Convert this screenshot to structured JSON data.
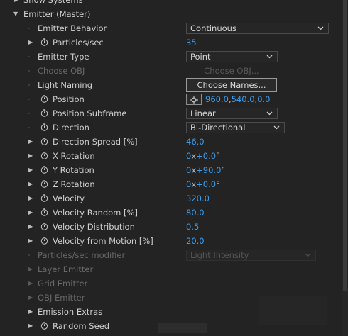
{
  "show_systems_label": "Show Systems",
  "emitter_title": "Emitter (Master)",
  "rows": {
    "emitter_behavior": {
      "label": "Emitter Behavior",
      "value": "Continuous"
    },
    "particles_sec": {
      "label": "Particles/sec",
      "value": "35"
    },
    "emitter_type": {
      "label": "Emitter Type",
      "value": "Point"
    },
    "choose_obj": {
      "label": "Choose OBJ",
      "value": "Choose OBJ..."
    },
    "light_naming": {
      "label": "Light Naming",
      "value": "Choose Names..."
    },
    "position": {
      "label": "Position",
      "x": "960.0",
      "y": "540.0",
      "z": "0.0"
    },
    "position_subframe": {
      "label": "Position Subframe",
      "value": "Linear"
    },
    "direction": {
      "label": "Direction",
      "value": "Bi-Directional"
    },
    "direction_spread": {
      "label": "Direction Spread [%]",
      "value": "46.0"
    },
    "x_rotation": {
      "label": "X Rotation",
      "rev": "0",
      "x": "x",
      "deg": "+0.0",
      "unit": "°"
    },
    "y_rotation": {
      "label": "Y Rotation",
      "rev": "0",
      "x": "x",
      "deg": "+90.0",
      "unit": "°"
    },
    "z_rotation": {
      "label": "Z Rotation",
      "rev": "0",
      "x": "x",
      "deg": "+0.0",
      "unit": "°"
    },
    "velocity": {
      "label": "Velocity",
      "value": "320.0"
    },
    "velocity_random": {
      "label": "Velocity Random [%]",
      "value": "80.0"
    },
    "velocity_distribution": {
      "label": "Velocity Distribution",
      "value": "0.5"
    },
    "velocity_from_motion": {
      "label": "Velocity from Motion [%]",
      "value": "20.0"
    },
    "particles_sec_modifier": {
      "label": "Particles/sec modifier",
      "value": "Light Intensity"
    },
    "layer_emitter": {
      "label": "Layer Emitter"
    },
    "grid_emitter": {
      "label": "Grid Emitter"
    },
    "obj_emitter": {
      "label": "OBJ Emitter"
    },
    "emission_extras": {
      "label": "Emission Extras"
    },
    "random_seed": {
      "label": "Random Seed"
    }
  },
  "colors": {
    "background": "#232323",
    "value_blue": "#3b9cec",
    "label": "#cfcfcf",
    "disabled": "#686868"
  },
  "icons": {
    "twirl_closed": "triangle-right-icon",
    "twirl_open": "triangle-down-icon",
    "stopwatch": "stopwatch-icon",
    "position_target": "crosshair-icon",
    "dropdown": "chevron-down-icon"
  }
}
